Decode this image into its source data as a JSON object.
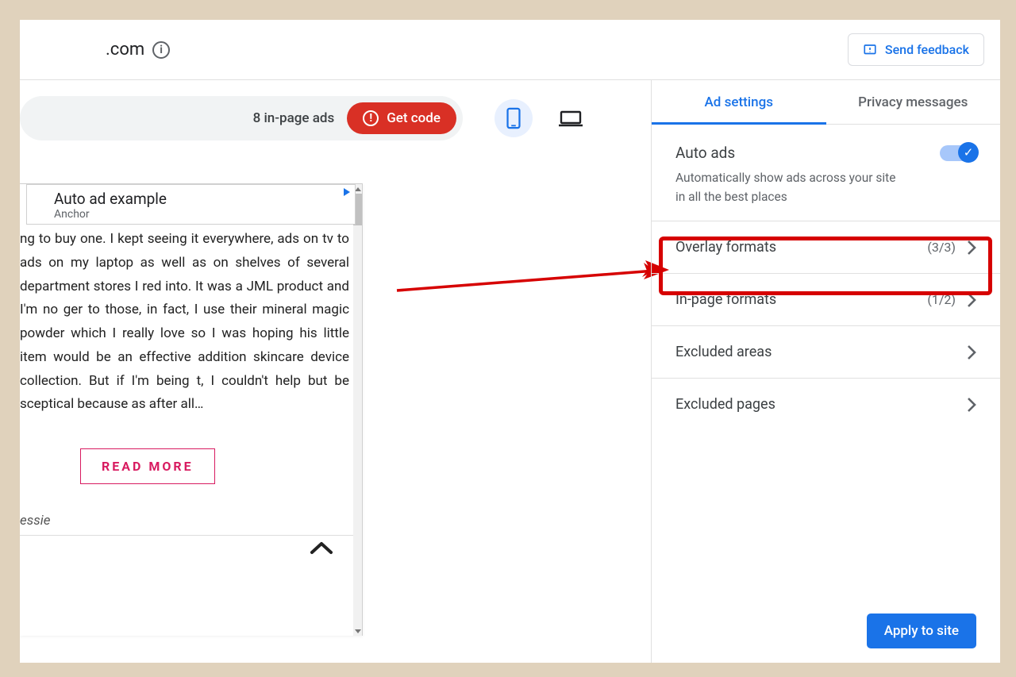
{
  "header": {
    "site": ".com",
    "feedback": "Send feedback"
  },
  "toolbar": {
    "inpage_count": "8 in-page ads",
    "getcode": "Get code"
  },
  "preview": {
    "ad_title": "Auto ad example",
    "ad_subtitle": "Anchor",
    "article_text": "ng to buy one. I kept seeing it everywhere, ads on tv to ads on my laptop as well as on shelves of several department stores I red into. It was a JML product and I'm no ger to those, in fact, I use their mineral magic powder which I really love so I was hoping his little item would be an effective addition skincare device collection. But if I'm being t, I couldn't help but be sceptical because as after all…",
    "readmore": "READ MORE",
    "author": "essie"
  },
  "tabs": {
    "ad_settings": "Ad settings",
    "privacy": "Privacy messages"
  },
  "auto_ads": {
    "title": "Auto ads",
    "desc": "Automatically show ads across your site in all the best places"
  },
  "settings": {
    "overlay": {
      "label": "Overlay formats",
      "count": "(3/3)"
    },
    "inpage": {
      "label": "In-page formats",
      "count": "(1/2)"
    },
    "excluded_areas": {
      "label": "Excluded areas"
    },
    "excluded_pages": {
      "label": "Excluded pages"
    }
  },
  "apply": "Apply to site"
}
